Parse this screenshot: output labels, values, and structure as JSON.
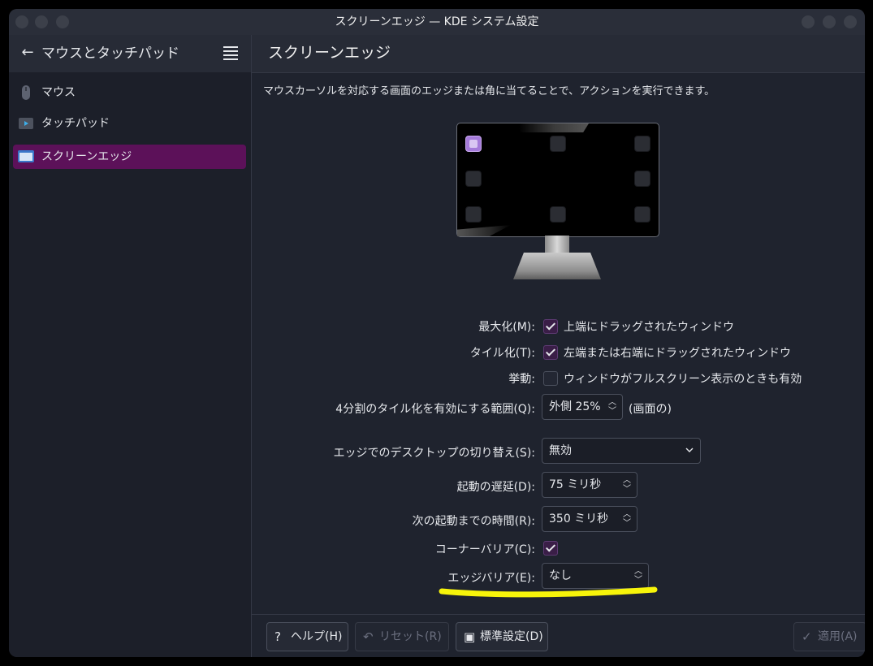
{
  "window": {
    "title": "スクリーンエッジ — KDE システム設定"
  },
  "sidebar": {
    "title": "マウスとタッチパッド",
    "items": [
      {
        "label": "マウス",
        "icon": "mouse-icon"
      },
      {
        "label": "タッチパッド",
        "icon": "touchpad-icon"
      },
      {
        "label": "スクリーンエッジ",
        "icon": "screen-edge-icon",
        "active": true
      }
    ]
  },
  "main": {
    "title": "スクリーンエッジ",
    "description": "マウスカーソルを対応する画面のエッジまたは角に当てることで、アクションを実行できます。"
  },
  "form": {
    "maximize": {
      "label": "最大化(M):",
      "checkbox": "上端にドラッグされたウィンドウ",
      "checked": true
    },
    "tile": {
      "label": "タイル化(T):",
      "checkbox": "左端または右端にドラッグされたウィンドウ",
      "checked": true
    },
    "behavior": {
      "label": "挙動:",
      "checkbox": "ウィンドウがフルスクリーン表示のときも有効",
      "checked": false
    },
    "quarter": {
      "label": "4分割のタイル化を有効にする範囲(Q):",
      "value": "外側 25%",
      "suffix": "(画面の)"
    },
    "desktop_switch": {
      "label": "エッジでのデスクトップの切り替え(S):",
      "value": "無効"
    },
    "activation_delay": {
      "label": "起動の遅延(D):",
      "value": "75 ミリ秒"
    },
    "reactivation_delay": {
      "label": "次の起動までの時間(R):",
      "value": "350 ミリ秒"
    },
    "corner_barrier": {
      "label": "コーナーバリア(C):",
      "checked": true
    },
    "edge_barrier": {
      "label": "エッジバリア(E):",
      "value": "なし"
    }
  },
  "footer": {
    "help": "ヘルプ(H)",
    "reset": "リセット(R)",
    "defaults": "標準設定(D)",
    "apply": "適用(A)"
  },
  "colors": {
    "accent": "#5c1159",
    "highlight_annotation": "#f7f40a",
    "active_edge": "#a47ad9"
  }
}
